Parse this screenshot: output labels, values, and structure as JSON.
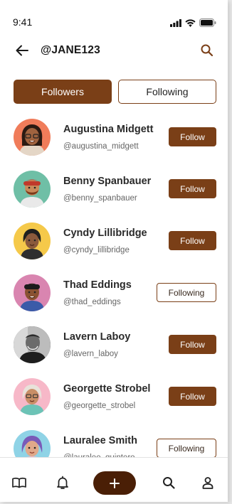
{
  "status_bar": {
    "time": "9:41"
  },
  "header": {
    "handle": "@JANE123"
  },
  "tabs": [
    {
      "label": "Followers",
      "active": true
    },
    {
      "label": "Following",
      "active": false
    }
  ],
  "users": [
    {
      "name": "Augustina Midgett",
      "username": "@augustina_midgett",
      "button": "Follow",
      "avatar_bg": "#f07c5a"
    },
    {
      "name": "Benny Spanbauer",
      "username": "@benny_spanbauer",
      "button": "Follow",
      "avatar_bg": "#6fbfa6"
    },
    {
      "name": "Cyndy Lillibridge",
      "username": "@cyndy_lillibridge",
      "button": "Follow",
      "avatar_bg": "#f5c94a"
    },
    {
      "name": "Thad Eddings",
      "username": "@thad_eddings",
      "button": "Following",
      "avatar_bg": "#d985b0"
    },
    {
      "name": "Lavern Laboy",
      "username": "@lavern_laboy",
      "button": "Follow",
      "avatar_bg": "#3a3a3a"
    },
    {
      "name": "Georgette Strobel",
      "username": "@georgette_strobel",
      "button": "Follow",
      "avatar_bg": "#f7b8c8"
    },
    {
      "name": "Lauralee Smith",
      "username": "@lauralee_quintero",
      "button": "Following",
      "avatar_bg": "#8fd3e6"
    }
  ],
  "colors": {
    "accent": "#7a3f17",
    "accent_dark": "#4a1f06"
  },
  "bottom_nav": [
    "book-icon",
    "bell-icon",
    "plus-icon",
    "search-icon",
    "profile-icon"
  ]
}
